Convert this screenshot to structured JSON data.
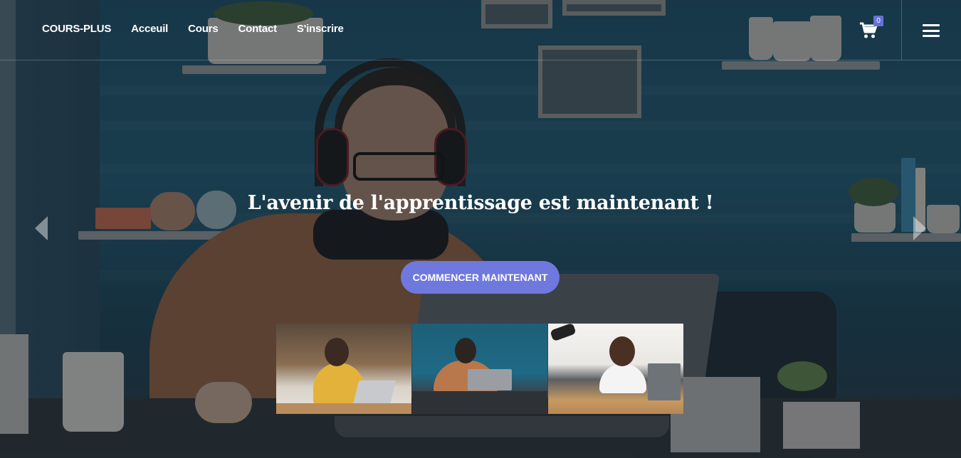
{
  "navbar": {
    "brand": "COURS-PLUS",
    "links": [
      "Acceuil",
      "Cours",
      "Contact",
      "S'inscrire"
    ],
    "cart_count": "0",
    "icons": {
      "cart": "cart-icon",
      "menu": "hamburger-menu-icon"
    },
    "badge_color": "#6672d8"
  },
  "hero": {
    "title": "L'avenir de l'apprentissage est maintenant !",
    "cta_label": "COMMENCER MAINTENANT",
    "cta_color": "#6f78dc",
    "carousel_icons": {
      "prev": "chevron-left-icon",
      "next": "chevron-right-icon"
    }
  },
  "thumbnails": [
    {
      "name": "thumbnail-girl-kitchen-laptop"
    },
    {
      "name": "thumbnail-woman-headphones-laptop"
    },
    {
      "name": "thumbnail-boy-desk-laptop"
    }
  ]
}
